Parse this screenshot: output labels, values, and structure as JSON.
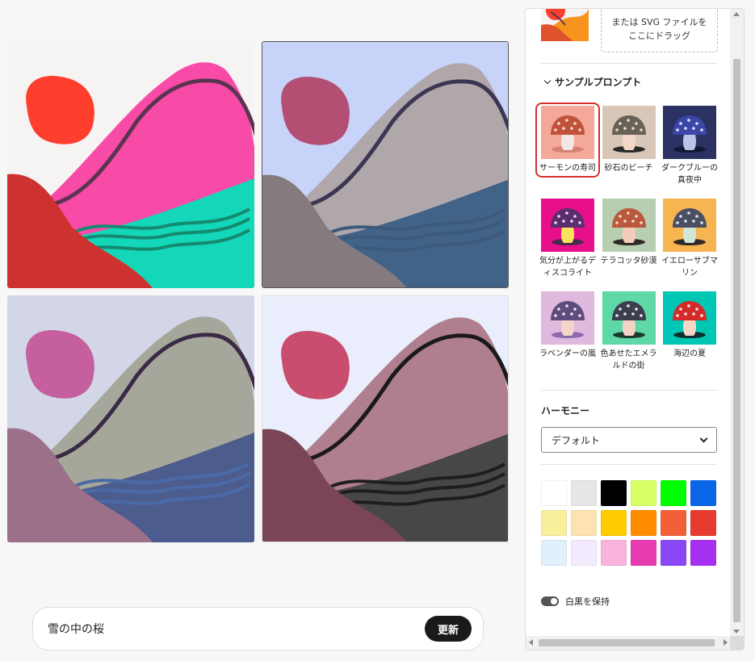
{
  "tiles": [
    {
      "bg": "#f6f3f3",
      "sun": "#fe3f2e",
      "mountain": "#f84aa7",
      "line": "#5b3450",
      "water": "#14d6b8",
      "wave": "#148a70",
      "hill": "#cd3230"
    },
    {
      "bg": "#c8d3fa",
      "sun": "#b44f74",
      "mountain": "#b0a7ab",
      "line": "#3b3652",
      "water": "#416388",
      "wave": "#3d5a7b",
      "hill": "#857b7e"
    },
    {
      "bg": "#d2d6e7",
      "sun": "#c55f9e",
      "mountain": "#a5a79a",
      "line": "#3a2a46",
      "water": "#4c5c8d",
      "wave": "#4a6aa8",
      "hill": "#9d7089"
    },
    {
      "bg": "#eaeefc",
      "sun": "#c94d6f",
      "mountain": "#b07f8d",
      "line": "#1a1a1a",
      "water": "#474747",
      "wave": "#1e1e1e",
      "hill": "#7a4655"
    }
  ],
  "prompt": {
    "value": "雪の中の桜",
    "button": "更新"
  },
  "panel": {
    "drop_text_1": "または SVG ファイルを",
    "drop_text_2": "ここにドラッグ",
    "sample_heading": "サンプルプロンプト",
    "samples": [
      {
        "label": "サーモンの寿司",
        "bg": "#f4a89a",
        "cap": "#c0533a",
        "dots": "#f3e0d0",
        "stem": "#f2e6e6",
        "shadow": "#d6826f"
      },
      {
        "label": "砂石のビーチ",
        "bg": "#d8c7b8",
        "cap": "#6a6156",
        "dots": "#e7ddd3",
        "stem": "#f4d6c6",
        "shadow": "#2c2a28"
      },
      {
        "label": "ダークブルーの真夜中",
        "bg": "#2b3262",
        "cap": "#3b48a8",
        "dots": "#dfe3ff",
        "stem": "#b9c4e8",
        "shadow": "#141834"
      },
      {
        "label": "気分が上がるディスコライト",
        "bg": "#e8108a",
        "cap": "#5a2d6e",
        "dots": "#f5d6e8",
        "stem": "#f9e45b",
        "shadow": "#4a2a4a"
      },
      {
        "label": "テラコッタ砂漠",
        "bg": "#b7cfb0",
        "cap": "#b9583d",
        "dots": "#f2dccf",
        "stem": "#f5cbb9",
        "shadow": "#2f2a26"
      },
      {
        "label": "イエローサブマリン",
        "bg": "#f7b552",
        "cap": "#4b4f63",
        "dots": "#e0e4ea",
        "stem": "#cfe6d8",
        "shadow": "#2f2a26"
      },
      {
        "label": "ラベンダーの嵐",
        "bg": "#e0b9de",
        "cap": "#5e4c7d",
        "dots": "#f1e5f5",
        "stem": "#f5d5c8",
        "shadow": "#8a6ab0"
      },
      {
        "label": "色あせたエメラルドの街",
        "bg": "#5fd8a8",
        "cap": "#3c3e4e",
        "dots": "#e8eef0",
        "stem": "#f4d2c4",
        "shadow": "#1d3a2e"
      },
      {
        "label": "海辺の夏",
        "bg": "#00c6b4",
        "cap": "#d52a2a",
        "dots": "#fce6e6",
        "stem": "#f5d7c7",
        "shadow": "#0e2f2c"
      }
    ],
    "harmony_heading": "ハーモニー",
    "harmony_value": "デフォルト",
    "colors": [
      "#ffffff",
      "#e6e6e6",
      "#000000",
      "#d9ff66",
      "#00ff00",
      "#0a66e6",
      "#f8f09c",
      "#fee3b0",
      "#ffcc00",
      "#ff8c00",
      "#f16038",
      "#e63b2e",
      "#e2f0fb",
      "#f3ebfd",
      "#f9b4de",
      "#e83ab0",
      "#8a48f5",
      "#a62ff0"
    ],
    "toggle_label": "白黒を保持"
  }
}
